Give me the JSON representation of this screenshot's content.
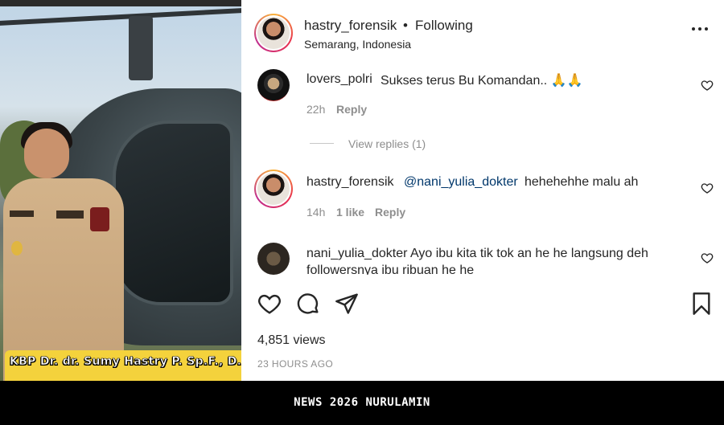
{
  "post": {
    "username": "hastry_forensik",
    "follow_state": "Following",
    "location": "Semarang, Indonesia",
    "media_caption": "KBP Dr. dr. Sumy Hastry P. Sp.F., D.F.M"
  },
  "comments": [
    {
      "username": "lovers_polri",
      "text": "Sukses terus Bu Komandan.. 🙏🙏",
      "time": "22h",
      "reply_label": "Reply"
    },
    {
      "username": "hastry_forensik",
      "mention": "@nani_yulia_dokter",
      "text": "hehehehhe malu ah",
      "time": "14h",
      "likes": "1 like",
      "reply_label": "Reply"
    },
    {
      "username": "nani_yulia_dokter",
      "text": "Ayo ibu kita tik tok an he he langsung deh followersnya ibu ribuan he he"
    }
  ],
  "view_replies_label": "View replies (1)",
  "stats": {
    "views": "4,851 views",
    "posted_ago": "23 HOURS AGO"
  },
  "footer": {
    "watermark": "NEWS 2026 NURULAMIN"
  },
  "icons": {
    "more": "more-horizontal-icon",
    "like": "heart-icon",
    "comment": "comment-bubble-icon",
    "share": "paper-plane-icon",
    "save": "bookmark-icon"
  }
}
